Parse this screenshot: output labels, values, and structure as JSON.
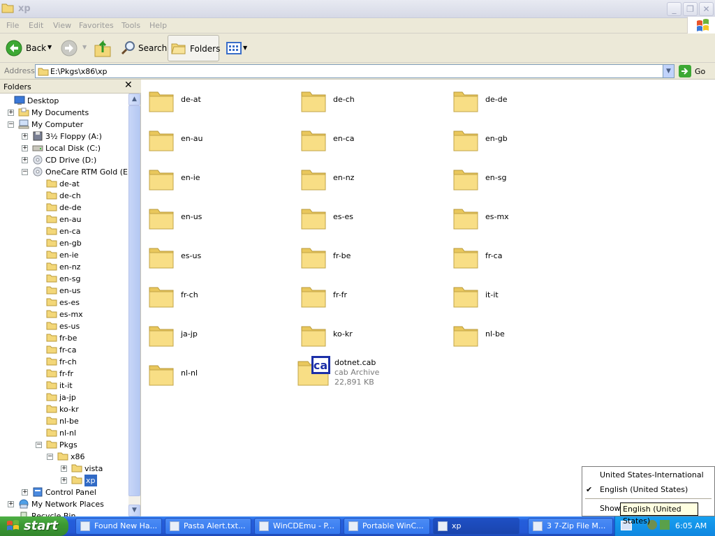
{
  "window": {
    "title": "xp"
  },
  "menu": [
    "File",
    "Edit",
    "View",
    "Favorites",
    "Tools",
    "Help"
  ],
  "toolbar": {
    "back": "Back",
    "search": "Search",
    "folders": "Folders"
  },
  "address": {
    "label": "Address",
    "path": "E:\\Pkgs\\x86\\xp",
    "go": "Go"
  },
  "folders_pane": {
    "title": "Folders",
    "tree": [
      {
        "label": "Desktop",
        "level": 0,
        "icon": "desktop-icon",
        "toggle": ""
      },
      {
        "label": "My Documents",
        "level": 1,
        "icon": "documents-icon",
        "toggle": "+"
      },
      {
        "label": "My Computer",
        "level": 1,
        "icon": "computer-icon",
        "toggle": "-"
      },
      {
        "label": "3½ Floppy (A:)",
        "level": 2,
        "icon": "floppy-icon",
        "toggle": "+"
      },
      {
        "label": "Local Disk (C:)",
        "level": 2,
        "icon": "disk-icon",
        "toggle": "+"
      },
      {
        "label": "CD Drive (D:)",
        "level": 2,
        "icon": "cd-icon",
        "toggle": "+"
      },
      {
        "label": "OneCare RTM Gold (E:)",
        "level": 2,
        "icon": "cd-icon",
        "toggle": "-"
      },
      {
        "label": "de-at",
        "level": 3,
        "icon": "folder-icon",
        "toggle": ""
      },
      {
        "label": "de-ch",
        "level": 3,
        "icon": "folder-icon",
        "toggle": ""
      },
      {
        "label": "de-de",
        "level": 3,
        "icon": "folder-icon",
        "toggle": ""
      },
      {
        "label": "en-au",
        "level": 3,
        "icon": "folder-icon",
        "toggle": ""
      },
      {
        "label": "en-ca",
        "level": 3,
        "icon": "folder-icon",
        "toggle": ""
      },
      {
        "label": "en-gb",
        "level": 3,
        "icon": "folder-icon",
        "toggle": ""
      },
      {
        "label": "en-ie",
        "level": 3,
        "icon": "folder-icon",
        "toggle": ""
      },
      {
        "label": "en-nz",
        "level": 3,
        "icon": "folder-icon",
        "toggle": ""
      },
      {
        "label": "en-sg",
        "level": 3,
        "icon": "folder-icon",
        "toggle": ""
      },
      {
        "label": "en-us",
        "level": 3,
        "icon": "folder-icon",
        "toggle": ""
      },
      {
        "label": "es-es",
        "level": 3,
        "icon": "folder-icon",
        "toggle": ""
      },
      {
        "label": "es-mx",
        "level": 3,
        "icon": "folder-icon",
        "toggle": ""
      },
      {
        "label": "es-us",
        "level": 3,
        "icon": "folder-icon",
        "toggle": ""
      },
      {
        "label": "fr-be",
        "level": 3,
        "icon": "folder-icon",
        "toggle": ""
      },
      {
        "label": "fr-ca",
        "level": 3,
        "icon": "folder-icon",
        "toggle": ""
      },
      {
        "label": "fr-ch",
        "level": 3,
        "icon": "folder-icon",
        "toggle": ""
      },
      {
        "label": "fr-fr",
        "level": 3,
        "icon": "folder-icon",
        "toggle": ""
      },
      {
        "label": "it-it",
        "level": 3,
        "icon": "folder-icon",
        "toggle": ""
      },
      {
        "label": "ja-jp",
        "level": 3,
        "icon": "folder-icon",
        "toggle": ""
      },
      {
        "label": "ko-kr",
        "level": 3,
        "icon": "folder-icon",
        "toggle": ""
      },
      {
        "label": "nl-be",
        "level": 3,
        "icon": "folder-icon",
        "toggle": ""
      },
      {
        "label": "nl-nl",
        "level": 3,
        "icon": "folder-icon",
        "toggle": ""
      },
      {
        "label": "Pkgs",
        "level": 3,
        "icon": "folder-icon",
        "toggle": "-"
      },
      {
        "label": "x86",
        "level": 4,
        "icon": "folder-icon",
        "toggle": "-"
      },
      {
        "label": "vista",
        "level": 5,
        "icon": "folder-icon",
        "toggle": "+"
      },
      {
        "label": "xp",
        "level": 5,
        "icon": "folder-icon",
        "toggle": "+",
        "selected": true
      },
      {
        "label": "Control Panel",
        "level": 2,
        "icon": "control-panel-icon",
        "toggle": "+"
      },
      {
        "label": "My Network Places",
        "level": 1,
        "icon": "network-icon",
        "toggle": "+"
      },
      {
        "label": "Recycle Bin",
        "level": 1,
        "icon": "recycle-bin-icon",
        "toggle": ""
      }
    ]
  },
  "items": [
    {
      "name": "de-at",
      "type": "folder"
    },
    {
      "name": "de-ch",
      "type": "folder"
    },
    {
      "name": "de-de",
      "type": "folder"
    },
    {
      "name": "en-au",
      "type": "folder"
    },
    {
      "name": "en-ca",
      "type": "folder"
    },
    {
      "name": "en-gb",
      "type": "folder"
    },
    {
      "name": "en-ie",
      "type": "folder"
    },
    {
      "name": "en-nz",
      "type": "folder"
    },
    {
      "name": "en-sg",
      "type": "folder"
    },
    {
      "name": "en-us",
      "type": "folder"
    },
    {
      "name": "es-es",
      "type": "folder"
    },
    {
      "name": "es-mx",
      "type": "folder"
    },
    {
      "name": "es-us",
      "type": "folder"
    },
    {
      "name": "fr-be",
      "type": "folder"
    },
    {
      "name": "fr-ca",
      "type": "folder"
    },
    {
      "name": "fr-ch",
      "type": "folder"
    },
    {
      "name": "fr-fr",
      "type": "folder"
    },
    {
      "name": "it-it",
      "type": "folder"
    },
    {
      "name": "ja-jp",
      "type": "folder"
    },
    {
      "name": "ko-kr",
      "type": "folder"
    },
    {
      "name": "nl-be",
      "type": "folder"
    },
    {
      "name": "nl-nl",
      "type": "folder"
    },
    {
      "name": "dotnet.cab",
      "type": "cab",
      "kind": "cab Archive",
      "size": "22,891 KB"
    }
  ],
  "taskbar": {
    "start": "start",
    "tasks": [
      "Found New Ha...",
      "Pasta Alert.txt...",
      "WinCDEmu - P...",
      "Portable WinC...",
      "xp",
      "3  7-Zip File M..."
    ],
    "clock": "6:05 AM"
  },
  "lang_menu": {
    "items": [
      "United States-International",
      "English (United States)",
      "Show"
    ],
    "checked_index": 1,
    "tooltip": "English (United States)"
  },
  "colors": {
    "selection": "#316ac5",
    "taskbar": "#245edb",
    "start": "#3c9a34",
    "folder": "#f6d977"
  }
}
